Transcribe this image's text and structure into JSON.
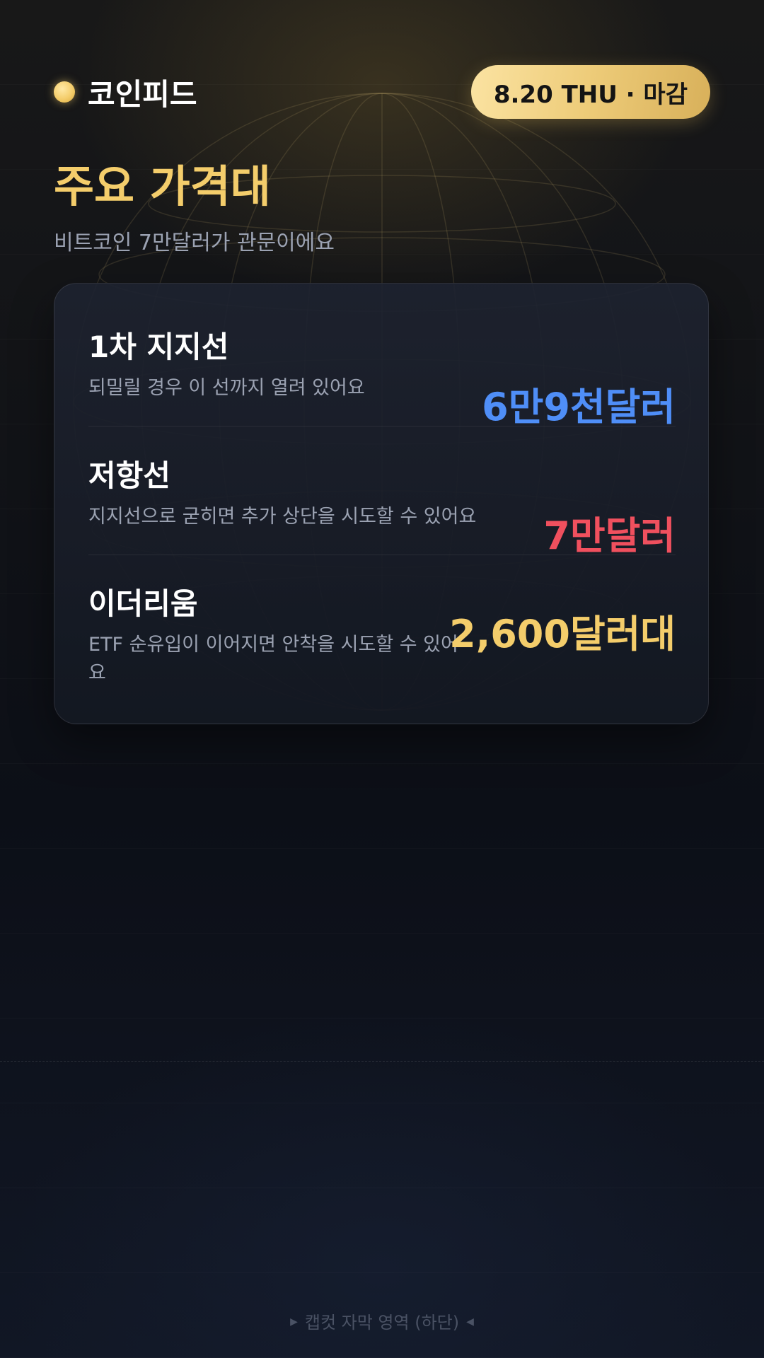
{
  "header": {
    "brand_name": "코인피드",
    "date_badge": "8.20 THU · 마감"
  },
  "title": "주요 가격대",
  "subtitle": "비트코인 7만달러가 관문이에요",
  "levels": [
    {
      "label": "1차 지지선",
      "description": "되밀릴 경우 이 선까지 열려 있어요",
      "value": "6만9천달러",
      "color": "#4f8ef7"
    },
    {
      "label": "저항선",
      "description": "지지선으로 굳히면 추가 상단을 시도할 수 있어요",
      "value": "7만달러",
      "color": "#f0505e"
    },
    {
      "label": "이더리움",
      "description": "ETF 순유입이 이어지면 안착을 시도할 수 있어요",
      "value": "2,600달러대",
      "color": "#f4cd6b"
    }
  ],
  "footer": {
    "caption": "캡컷 자막 영역 (하단)",
    "left_marker_icon": "triangle-right-icon",
    "right_marker_icon": "triangle-left-icon"
  },
  "colors": {
    "accent_gold": "#f4cd6b",
    "support_blue": "#4f8ef7",
    "resistance_red": "#f0505e"
  }
}
